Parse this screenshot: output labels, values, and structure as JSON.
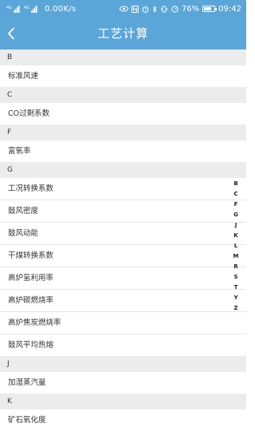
{
  "status_bar": {
    "network_speed": "0.00K/s",
    "battery_percent": "76%",
    "battery_level": 0.76,
    "time": "09:42",
    "signal_label_1": "4G",
    "signal_label_2": "4G"
  },
  "header": {
    "title": "工艺计算"
  },
  "sections": [
    {
      "letter": "B",
      "items": [
        "标准风速"
      ]
    },
    {
      "letter": "C",
      "items": [
        "CO过剩系数"
      ]
    },
    {
      "letter": "F",
      "items": [
        "富氧率"
      ]
    },
    {
      "letter": "G",
      "items": [
        "工况转换系数",
        "鼓风密度",
        "鼓风动能",
        "干煤转换系数",
        "高炉氢利用率",
        "高炉碳燃烧率",
        "高炉焦炭燃烧率",
        "鼓风平均热熔"
      ]
    },
    {
      "letter": "J",
      "items": [
        "加湿蒸汽量"
      ]
    },
    {
      "letter": "K",
      "items": [
        "矿石氧化度"
      ]
    }
  ],
  "index_letters": [
    "B",
    "C",
    "F",
    "G",
    "J",
    "K",
    "L",
    "M",
    "R",
    "S",
    "T",
    "Y",
    "Z"
  ],
  "colors": {
    "primary": "#5ba6d9",
    "section_bg": "#ececec"
  }
}
